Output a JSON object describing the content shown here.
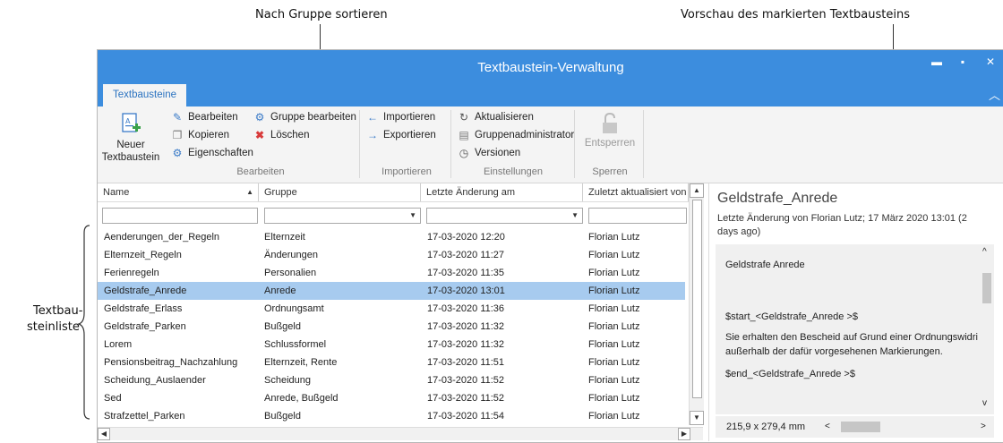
{
  "annotations": {
    "sort_by_group": "Nach Gruppe sortieren",
    "preview_marked": "Vorschau des markierten Textbausteins",
    "list_line1": "Textbau-",
    "list_line2": "steinliste"
  },
  "window": {
    "title": "Textbaustein-Verwaltung",
    "tab": "Textbausteine"
  },
  "ribbon": {
    "new_line1": "Neuer",
    "new_line2": "Textbaustein",
    "edit": "Bearbeiten",
    "copy": "Kopieren",
    "properties": "Eigenschaften",
    "edit_group": "Gruppe bearbeiten",
    "delete": "Löschen",
    "group_edit_label": "Bearbeiten",
    "import": "Importieren",
    "export": "Exportieren",
    "group_import_label": "Importieren",
    "refresh": "Aktualisieren",
    "group_admin": "Gruppenadministrator",
    "versions": "Versionen",
    "group_settings_label": "Einstellungen",
    "unlock": "Entsperren",
    "group_lock_label": "Sperren"
  },
  "list": {
    "columns": [
      "Name",
      "Gruppe",
      "Letzte Änderung am",
      "Zuletzt aktualisiert von"
    ],
    "rows": [
      [
        "Aenderungen_der_Regeln",
        "Elternzeit",
        "17-03-2020 12:20",
        "Florian Lutz"
      ],
      [
        "Elternzeit_Regeln",
        "Änderungen",
        "17-03-2020 11:27",
        "Florian Lutz"
      ],
      [
        "Ferienregeln",
        "Personalien",
        "17-03-2020 11:35",
        "Florian Lutz"
      ],
      [
        "Geldstrafe_Anrede",
        "Anrede",
        "17-03-2020 13:01",
        "Florian Lutz"
      ],
      [
        "Geldstrafe_Erlass",
        "Ordnungsamt",
        "17-03-2020 11:36",
        "Florian Lutz"
      ],
      [
        "Geldstrafe_Parken",
        "Bußgeld",
        "17-03-2020 11:32",
        "Florian Lutz"
      ],
      [
        "Lorem",
        "Schlussformel",
        "17-03-2020 11:32",
        "Florian Lutz"
      ],
      [
        "Pensionsbeitrag_Nachzahlung",
        "Elternzeit, Rente",
        "17-03-2020 11:51",
        "Florian Lutz"
      ],
      [
        "Scheidung_Auslaender",
        "Scheidung",
        "17-03-2020 11:52",
        "Florian Lutz"
      ],
      [
        "Sed",
        "Anrede, Bußgeld",
        "17-03-2020 11:52",
        "Florian Lutz"
      ],
      [
        "Strafzettel_Parken",
        "Bußgeld",
        "17-03-2020 11:54",
        "Florian Lutz"
      ]
    ],
    "selected_index": 3
  },
  "preview": {
    "title": "Geldstrafe_Anrede",
    "meta": "Letzte Änderung von Florian Lutz; 17 März 2020 13:01 (2 days ago)",
    "lines": [
      "Geldstrafe Anrede",
      "$start_<Geldstrafe_Anrede >$",
      "Sie erhalten den Bescheid auf Grund einer Ordnungswidri",
      "außerhalb der dafür vorgesehenen Markierungen.",
      "$end_<Geldstrafe_Anrede >$"
    ],
    "page_size": "215,9 x 279,4 mm"
  },
  "colors": {
    "titlebar": "#3c8dde",
    "selection": "#a7cbef",
    "ribbon": "#f4f4f4"
  }
}
